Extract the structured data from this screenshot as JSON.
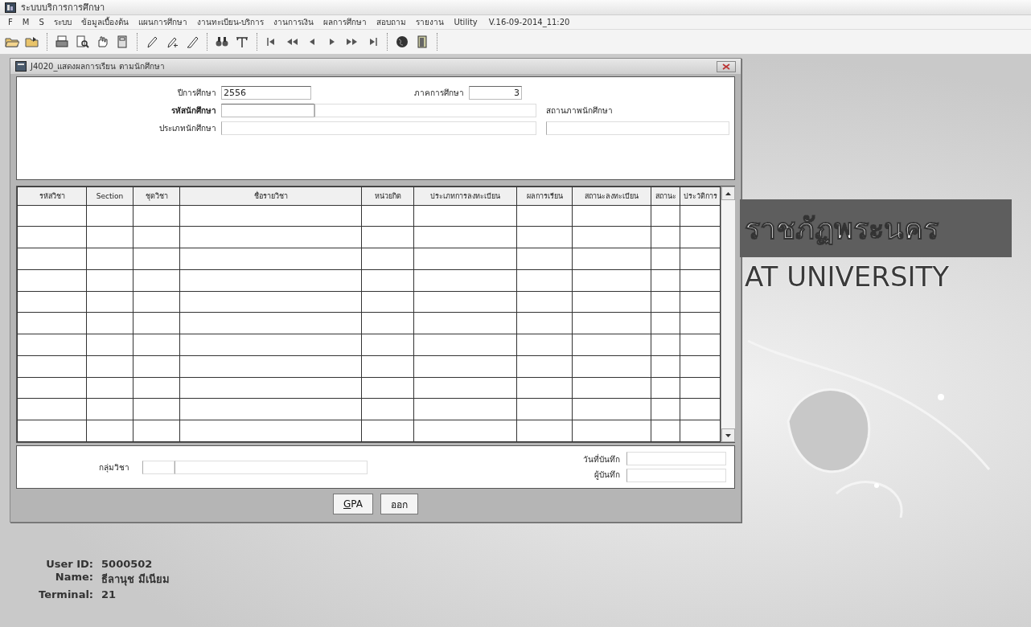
{
  "app": {
    "title": "ระบบบริการการศึกษา"
  },
  "menu": {
    "items": [
      "F",
      "M",
      "S",
      "ระบบ",
      "ข้อมูลเบื้องต้น",
      "แผนการศึกษา",
      "งานทะเบียน-บริการ",
      "งานการเงิน",
      "ผลการศึกษา",
      "สอบถาม",
      "รายงาน",
      "Utility"
    ],
    "version": "V.16-09-2014_11:20"
  },
  "form": {
    "title": "J4020_แสดงผลการเรียน ตามนักศึกษา",
    "header": {
      "year_label": "ปีการศึกษา",
      "year_value": "2556",
      "semester_label": "ภาคการศึกษา",
      "semester_value": "3",
      "student_id_label": "รหัสนักศึกษา",
      "status_label": "สถานภาพนักศึกษา",
      "student_type_label": "ประเภทนักศึกษา"
    },
    "table": {
      "columns": [
        "รหัสวิชา",
        "Section",
        "ชุดวิชา",
        "ชื่อรายวิชา",
        "หน่วยกิต",
        "ประเภทการลงทะเบียน",
        "ผลการเรียน",
        "สถานะลงทะเบียน",
        "สถานะ",
        "ประวัติการ"
      ]
    },
    "footer": {
      "group_label": "กลุ่มวิชา",
      "saved_date_label": "วันที่บันทึก",
      "saved_by_label": "ผู้บันทึก"
    },
    "buttons": [
      {
        "label": "GPA",
        "access_key_underlined": true
      },
      {
        "label": "ออก",
        "access_key_underlined": false
      }
    ]
  },
  "user": {
    "id_label": "User ID:",
    "id": "5000502",
    "name_label": "Name:",
    "name": "ธีลานุช มีเนียม",
    "terminal_label": "Terminal:",
    "terminal": "21"
  },
  "banner": {
    "thai": "ราชภัฏพระนคร",
    "english": "AT UNIVERSITY"
  }
}
